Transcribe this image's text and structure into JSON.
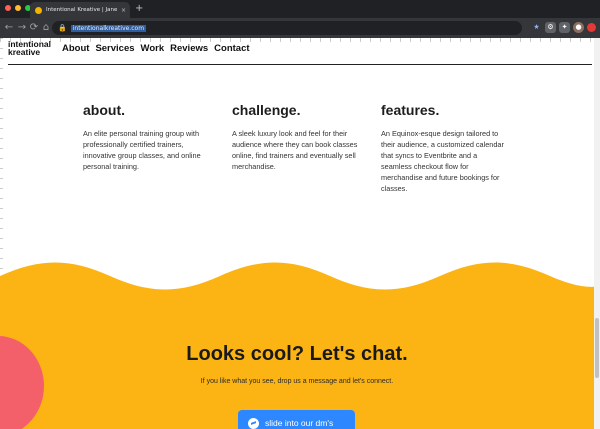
{
  "browser": {
    "tab_title": "Intentional Kreative | Jane Sn...",
    "tab_close": "×",
    "new_tab": "+",
    "back": "←",
    "forward": "→",
    "reload": "⟳",
    "home": "⌂",
    "url": "intentionalkreative.com",
    "lock_icon": "🔒",
    "extensions": [
      "★",
      "⚙",
      "✦",
      "●"
    ]
  },
  "site": {
    "logo_line1": "intentional",
    "logo_line2": "kreative",
    "nav": [
      "About",
      "Services",
      "Work",
      "Reviews",
      "Contact"
    ]
  },
  "columns": [
    {
      "heading": "about.",
      "body": "An elite personal training group with professionally certified trainers, innovative group classes, and online personal training."
    },
    {
      "heading": "challenge.",
      "body": "A sleek luxury look and feel for their audience where they can book classes online, find trainers and eventually sell merchandise."
    },
    {
      "heading": "features.",
      "body": "An Equinox-esque design tailored to their audience, a customized calendar that syncs to Eventbrite and a seamless checkout flow for merchandise and future bookings for classes."
    }
  ],
  "cta": {
    "title": "Looks cool? Let's chat.",
    "subtitle": "If you like what you see, drop us a message and let's connect.",
    "button": "slide into our dm's"
  },
  "colors": {
    "accent_yellow": "#fbb414",
    "accent_pink": "#f4606a",
    "button_blue": "#2d88ff"
  }
}
